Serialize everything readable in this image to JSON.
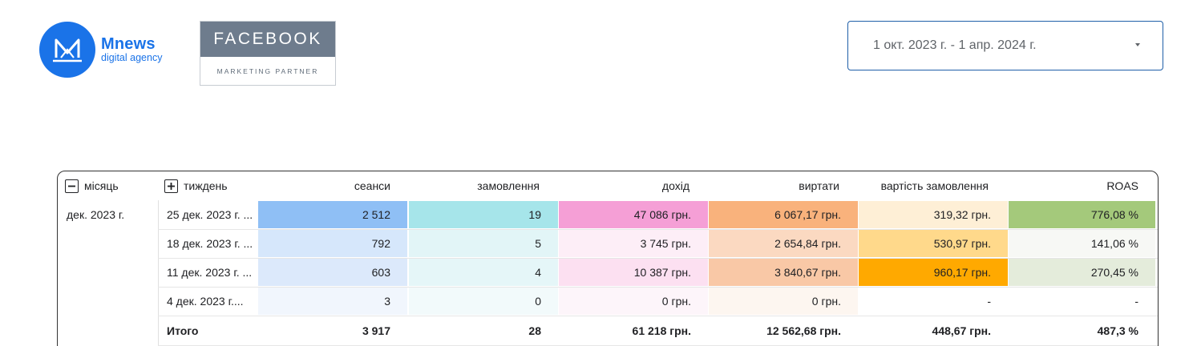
{
  "header": {
    "logo_name": "Mnews",
    "logo_sub": "digital agency",
    "partner_title": "FACEBOOK",
    "partner_sub": "MARKETING PARTNER"
  },
  "date_picker": {
    "value": "1 окт. 2023 г. - 1 апр. 2024 г."
  },
  "table": {
    "columns": [
      "місяць",
      "тиждень",
      "сеанси",
      "замовлення",
      "дохід",
      "виртати",
      "вартість замовлення",
      "ROAS"
    ],
    "month": "дек. 2023 г.",
    "rows": [
      {
        "week": "25 дек. 2023 г. ...",
        "sessions": "2 512",
        "orders": "19",
        "revenue": "47 086 грн.",
        "spend": "6 067,17 грн.",
        "order_cost": "319,32 грн.",
        "roas": "776,08 %"
      },
      {
        "week": "18 дек. 2023 г. ...",
        "sessions": "792",
        "orders": "5",
        "revenue": "3 745 грн.",
        "spend": "2 654,84 грн.",
        "order_cost": "530,97 грн.",
        "roas": "141,06 %"
      },
      {
        "week": "11 дек. 2023 г. ...",
        "sessions": "603",
        "orders": "4",
        "revenue": "10 387 грн.",
        "spend": "3 840,67 грн.",
        "order_cost": "960,17 грн.",
        "roas": "270,45 %"
      },
      {
        "week": "4 дек. 2023 г....",
        "sessions": "3",
        "orders": "0",
        "revenue": "0 грн.",
        "spend": "0 грн.",
        "order_cost": "-",
        "roas": "-"
      }
    ],
    "total": {
      "label": "Итого",
      "sessions": "3 917",
      "orders": "28",
      "revenue": "61 218 грн.",
      "spend": "12 562,68 грн.",
      "order_cost": "448,67 грн.",
      "roas": "487,3 %"
    },
    "heat_colors": {
      "sessions": [
        "#8fbff5",
        "#d6e7fb",
        "#dce9fb",
        "#f1f6fd"
      ],
      "orders": [
        "#a6e5ea",
        "#e2f5f7",
        "#e5f6f8",
        "#f2fafb"
      ],
      "revenue": [
        "#f59fd6",
        "#fdeef7",
        "#fce0f1",
        "#fdf5fa"
      ],
      "spend": [
        "#f9b27c",
        "#fbd9c1",
        "#f9c8a6",
        "#fdf6f0"
      ],
      "order_cost": [
        "#feefd6",
        "#ffd98b",
        "#ffa900",
        "#ffffff"
      ],
      "roas": [
        "#a4c97b",
        "#f7f8f5",
        "#e4ecdb",
        "#ffffff"
      ]
    }
  }
}
